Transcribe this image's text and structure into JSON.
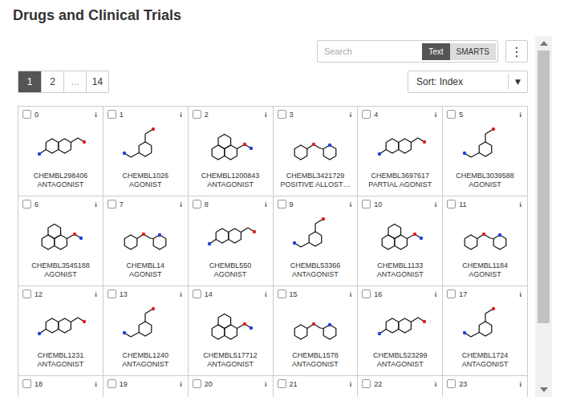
{
  "title": "Drugs and Clinical Trials",
  "search": {
    "placeholder": "Search",
    "modes": [
      {
        "label": "Text",
        "selected": true
      },
      {
        "label": "SMARTS",
        "selected": false
      }
    ]
  },
  "menu_button": {
    "glyph": "⋮"
  },
  "pagination": [
    {
      "label": "1",
      "selected": true,
      "disabled": false
    },
    {
      "label": "2",
      "selected": false,
      "disabled": false
    },
    {
      "label": "...",
      "selected": false,
      "disabled": true
    },
    {
      "label": "14",
      "selected": false,
      "disabled": false
    }
  ],
  "sort": {
    "label": "Sort: Index",
    "caret": "▼"
  },
  "info_glyph": "i",
  "cards": [
    {
      "index": "0",
      "compound": "CHEMBL298406",
      "action": "ANTAGONIST",
      "checked": false
    },
    {
      "index": "1",
      "compound": "CHEMBL1026",
      "action": "AGONIST",
      "checked": false
    },
    {
      "index": "2",
      "compound": "CHEMBL1200843",
      "action": "ANTAGONIST",
      "checked": false
    },
    {
      "index": "3",
      "compound": "CHEMBL3421729",
      "action": "POSITIVE ALLOST…",
      "checked": false
    },
    {
      "index": "4",
      "compound": "CHEMBL3697617",
      "action": "PARTIAL AGONIST",
      "checked": false
    },
    {
      "index": "5",
      "compound": "CHEMBL3039588",
      "action": "AGONIST",
      "checked": false
    },
    {
      "index": "6",
      "compound": "CHEMBL3545188",
      "action": "AGONIST",
      "checked": false
    },
    {
      "index": "7",
      "compound": "CHEMBL14",
      "action": "AGONIST",
      "checked": false
    },
    {
      "index": "8",
      "compound": "CHEMBL550",
      "action": "AGONIST",
      "checked": false
    },
    {
      "index": "9",
      "compound": "CHEMBL53366",
      "action": "ANTAGONIST",
      "checked": false
    },
    {
      "index": "10",
      "compound": "CHEMBL1133",
      "action": "ANTAGONIST",
      "checked": false
    },
    {
      "index": "11",
      "compound": "CHEMBL1184",
      "action": "AGONIST",
      "checked": false
    },
    {
      "index": "12",
      "compound": "CHEMBL1231",
      "action": "ANTAGONIST",
      "checked": false
    },
    {
      "index": "13",
      "compound": "CHEMBL1240",
      "action": "ANTAGONIST",
      "checked": false
    },
    {
      "index": "14",
      "compound": "CHEMBL517712",
      "action": "ANTAGONIST",
      "checked": false
    },
    {
      "index": "15",
      "compound": "CHEMBL1578",
      "action": "ANTAGONIST",
      "checked": false
    },
    {
      "index": "16",
      "compound": "CHEMBL523299",
      "action": "ANTAGONIST",
      "checked": false
    },
    {
      "index": "17",
      "compound": "CHEMBL1724",
      "action": "ANTAGONIST",
      "checked": false
    }
  ],
  "cut_off_cards": [
    {
      "index": "18",
      "checked": false
    },
    {
      "index": "19",
      "checked": false
    },
    {
      "index": "20",
      "checked": false
    },
    {
      "index": "21",
      "checked": false
    },
    {
      "index": "22",
      "checked": false
    },
    {
      "index": "23",
      "checked": false
    }
  ]
}
